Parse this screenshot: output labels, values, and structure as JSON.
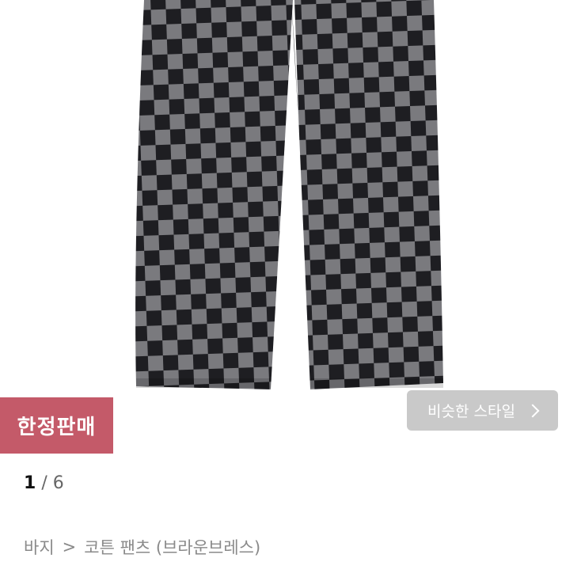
{
  "product": {
    "image_alt": "checkered pants",
    "colors": {
      "check_dark": "#1e1e22",
      "check_light": "#7a7a7e"
    }
  },
  "badge": {
    "label": "한정판매",
    "color": "#c45a69"
  },
  "similar_button": {
    "label": "비슷한 스타일",
    "icon": "chevron-right-icon"
  },
  "pager": {
    "current": "1",
    "separator": "/",
    "total": "6"
  },
  "breadcrumb": {
    "category": "바지",
    "separator": ">",
    "item": "코튼 팬츠 (브라운브레스)"
  }
}
